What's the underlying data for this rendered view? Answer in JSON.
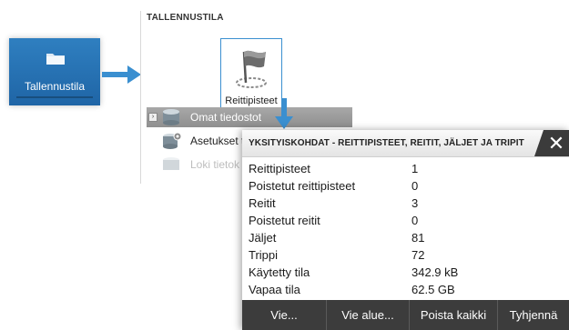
{
  "tile": {
    "label": "Tallennustila",
    "icon": "folder-icon"
  },
  "storage": {
    "title": "TALLENNUSTILA",
    "waypoints": {
      "label": "Reittipisteet",
      "icon": "flag-icon"
    },
    "items": [
      {
        "label": "Omat tiedostot",
        "icon": "database-icon"
      },
      {
        "label": "Asetukset t",
        "icon": "database-gear-icon"
      },
      {
        "label": "Loki tietok",
        "icon": "database-icon"
      }
    ]
  },
  "dialog": {
    "title": "YKSITYISKOHDAT - REITTIPISTEET, REITIT, JÄLJET JA TRIPIT",
    "close_glyph": "✕",
    "rows": [
      {
        "label": "Reittipisteet",
        "value": "1"
      },
      {
        "label": "Poistetut reittipisteet",
        "value": "0"
      },
      {
        "label": "Reitit",
        "value": "3"
      },
      {
        "label": "Poistetut reitit",
        "value": "0"
      },
      {
        "label": "Jäljet",
        "value": "81"
      },
      {
        "label": "Trippi",
        "value": "72"
      },
      {
        "label": "Käytetty tila",
        "value": "342.9 kB"
      },
      {
        "label": "Vapaa tila",
        "value": "62.5 GB"
      }
    ],
    "buttons": [
      "Vie...",
      "Vie alue...",
      "Poista kaikki",
      "Tyhjennä"
    ]
  },
  "colors": {
    "accent": "#3a8fd0",
    "tile": "#1f65a6",
    "footer": "#3c3c3c"
  }
}
